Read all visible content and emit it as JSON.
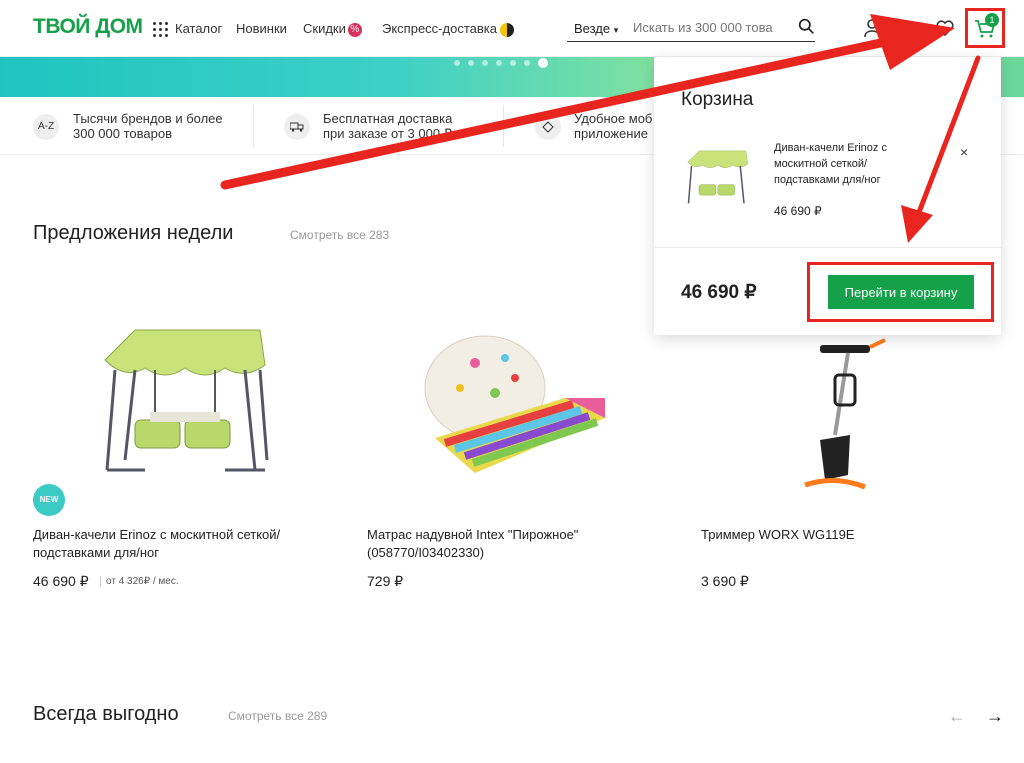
{
  "header": {
    "logo": "ТВОЙ ДОМ",
    "catalog": "Каталог",
    "news": "Новинки",
    "discounts": "Скидки",
    "discount_badge": "%",
    "express": "Экспресс-доставка",
    "search_scope": "Везде",
    "search_placeholder": "Искать из 300 000 това",
    "cart_count": "1"
  },
  "features": [
    {
      "icon_text": "A-Z",
      "line1": "Тысячи брендов и более",
      "line2": "300 000 товаров"
    },
    {
      "icon_text": "",
      "line1": "Бесплатная доставка",
      "line2": "при заказе от 3 000 ₽"
    },
    {
      "icon_text": "",
      "line1": "Удобное моб",
      "line2": "приложение"
    }
  ],
  "weekly": {
    "title": "Предложения недели",
    "see_all": "Смотреть все 283",
    "products": [
      {
        "name_line1": "Диван-качели Erinoz с москитной сеткой/",
        "name_line2": "подставками для/ног",
        "price": "46 690 ₽",
        "installment": "от 4 326₽ / мес.",
        "badge": "NEW"
      },
      {
        "name_line1": "Матрас надувной Intex \"Пирожное\"",
        "name_line2": "(058770/I03402330)",
        "price": "729 ₽"
      },
      {
        "name_line1": "Триммер WORX WG119E",
        "name_line2": "",
        "price": "3 690 ₽"
      }
    ]
  },
  "always": {
    "title": "Всегда выгодно",
    "see_all": "Смотреть все 289"
  },
  "cart_popup": {
    "title": "Корзина",
    "item_name_1": "Диван-качели Erinoz с",
    "item_name_2": "москитной сеткой/",
    "item_name_3": "подставками для/ног",
    "item_price": "46 690 ₽",
    "close": "×",
    "total": "46 690 ₽",
    "checkout_label": "Перейти в корзину"
  },
  "colors": {
    "brand": "#14a14a",
    "annotation": "#e8251f",
    "banner": "#1fc4c0"
  },
  "banner": {
    "dot_count": 7,
    "active_dot": 7
  }
}
